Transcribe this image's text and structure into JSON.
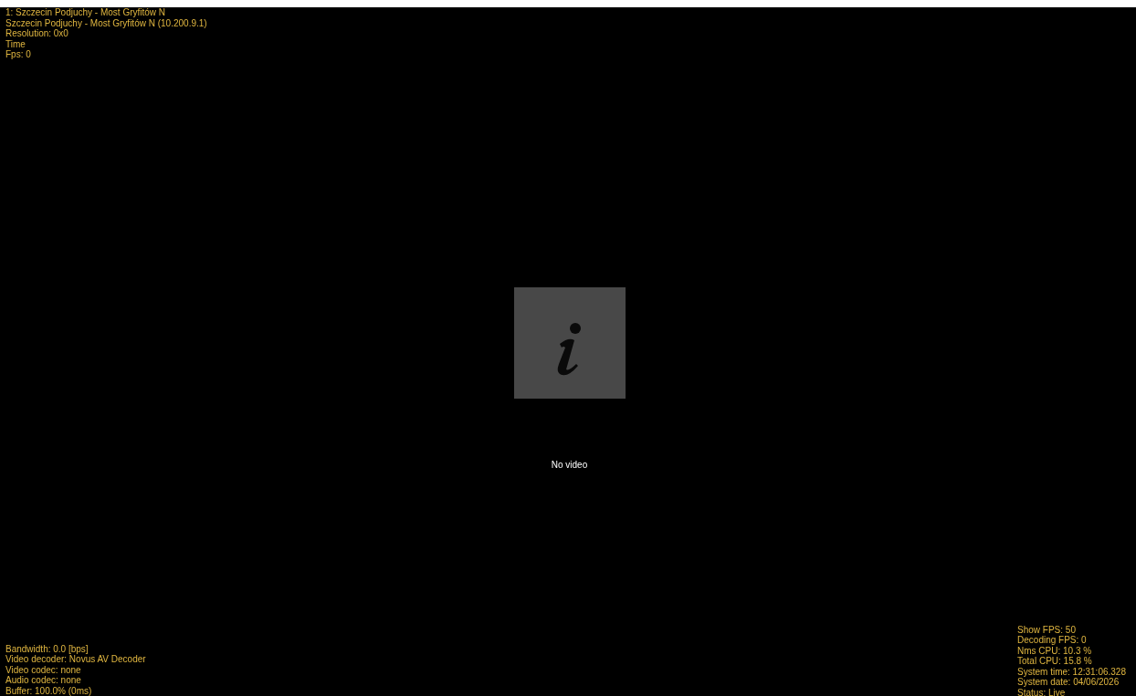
{
  "top_left_info": [
    "1: Szczecin Podjuchy - Most Gryfitów N",
    "Szczecin Podjuchy - Most Gryfitów N (10.200.9.1)",
    "Resolution: 0x0",
    "Time",
    "Fps: 0"
  ],
  "center": {
    "message": "No video"
  },
  "bottom_left_info": [
    "Bandwidth: 0.0 [bps]",
    "Video decoder: Novus AV Decoder",
    "Video codec: none",
    "Audio codec: none",
    "Buffer: 100.0% (0ms)"
  ],
  "bottom_right_info": [
    "Show FPS: 50",
    "Decoding FPS: 0",
    "Nms CPU: 10.3 %",
    "Total CPU: 15.8 %",
    "System time: 12:31:06.328",
    "System date: 04/06/2026",
    "Status: Live"
  ]
}
